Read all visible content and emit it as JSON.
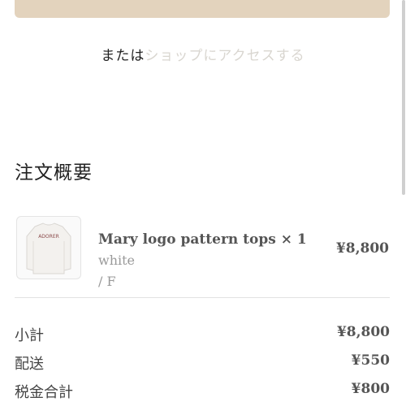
{
  "or_prefix": "または",
  "shop_link": "ショップにアクセスする",
  "summary_title": "注文概要",
  "product": {
    "name": "Mary logo pattern tops × 1",
    "variant_part1": "white",
    "variant_part2": "/ F",
    "price": "¥8,800",
    "thumb_label": "ADORER"
  },
  "totals": [
    {
      "label": "小計",
      "value": "¥8,800"
    },
    {
      "label": "配送",
      "value": "¥550"
    },
    {
      "label": "税金合計",
      "value": "¥800"
    }
  ],
  "colors": {
    "accent_button": "#e3d3bd",
    "link_muted": "#d9d6d0"
  }
}
